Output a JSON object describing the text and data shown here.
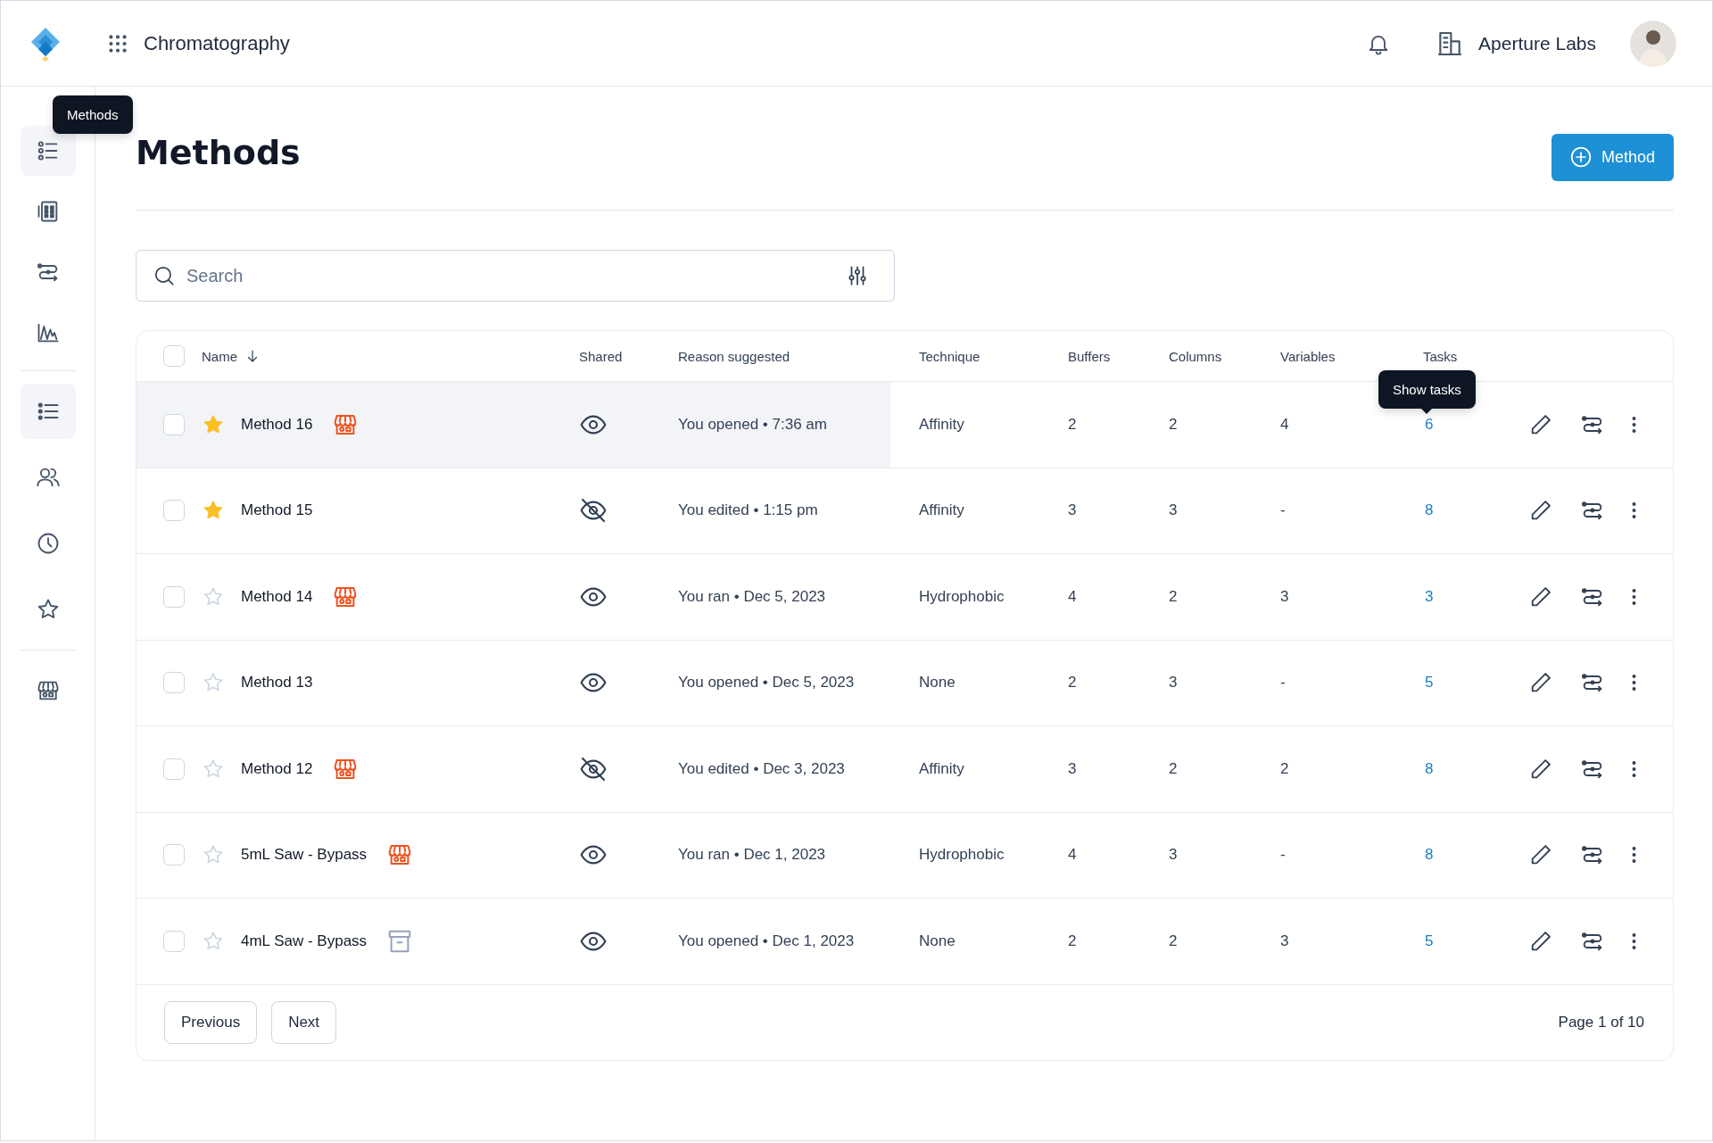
{
  "app": {
    "title": "Chromatography"
  },
  "org": {
    "name": "Aperture Labs"
  },
  "sidebar": {
    "tooltip": "Methods",
    "groups": [
      {
        "items": [
          {
            "selected": true
          },
          {
            "selected": false
          },
          {
            "selected": false
          },
          {
            "selected": false
          }
        ]
      },
      {
        "items": [
          {
            "selected": true
          },
          {
            "selected": false
          },
          {
            "selected": false
          },
          {
            "selected": false
          }
        ]
      },
      {
        "items": [
          {
            "selected": false
          }
        ]
      }
    ]
  },
  "page": {
    "title": "Methods",
    "new_button": "Method"
  },
  "search": {
    "placeholder": "Search"
  },
  "table": {
    "select_all": {
      "checked": false
    },
    "columns": [
      "Name",
      "Shared",
      "Reason suggested",
      "Technique",
      "Buffers",
      "Columns",
      "Variables",
      "Tasks"
    ],
    "tasks_tooltip": "Show tasks",
    "rows": [
      {
        "checked": false,
        "hovered": true,
        "starred": true,
        "name": "Method 16",
        "in_store": true,
        "archived": false,
        "shared": true,
        "reason": "You opened • 7:36 am",
        "technique": "Affinity",
        "buffers": "2",
        "columns": "2",
        "variables": "4",
        "tasks": "6"
      },
      {
        "checked": false,
        "hovered": false,
        "starred": true,
        "name": "Method 15",
        "in_store": false,
        "archived": false,
        "shared": false,
        "reason": "You edited • 1:15 pm",
        "technique": "Affinity",
        "buffers": "3",
        "columns": "3",
        "variables": "-",
        "tasks": "8"
      },
      {
        "checked": false,
        "hovered": false,
        "starred": false,
        "name": "Method 14",
        "in_store": true,
        "archived": false,
        "shared": true,
        "reason": "You ran • Dec 5, 2023",
        "technique": "Hydrophobic",
        "buffers": "4",
        "columns": "2",
        "variables": "3",
        "tasks": "3"
      },
      {
        "checked": false,
        "hovered": false,
        "starred": false,
        "name": "Method 13",
        "in_store": false,
        "archived": false,
        "shared": true,
        "reason": "You opened • Dec 5, 2023",
        "technique": "None",
        "buffers": "2",
        "columns": "3",
        "variables": "-",
        "tasks": "5"
      },
      {
        "checked": false,
        "hovered": false,
        "starred": false,
        "name": "Method 12",
        "in_store": true,
        "archived": false,
        "shared": false,
        "reason": "You edited • Dec 3, 2023",
        "technique": "Affinity",
        "buffers": "3",
        "columns": "2",
        "variables": "2",
        "tasks": "8"
      },
      {
        "checked": false,
        "hovered": false,
        "starred": false,
        "name": "5mL Saw - Bypass",
        "in_store": true,
        "archived": false,
        "shared": true,
        "reason": "You ran • Dec 1, 2023",
        "technique": "Hydrophobic",
        "buffers": "4",
        "columns": "3",
        "variables": "-",
        "tasks": "8"
      },
      {
        "checked": false,
        "hovered": false,
        "starred": false,
        "name": "4mL Saw - Bypass",
        "in_store": false,
        "archived": true,
        "shared": true,
        "reason": "You opened • Dec 1, 2023",
        "technique": "None",
        "buffers": "2",
        "columns": "2",
        "variables": "3",
        "tasks": "5"
      }
    ],
    "pagination": {
      "previous": "Previous",
      "next": "Next",
      "page": "Page 1 of 10"
    }
  }
}
